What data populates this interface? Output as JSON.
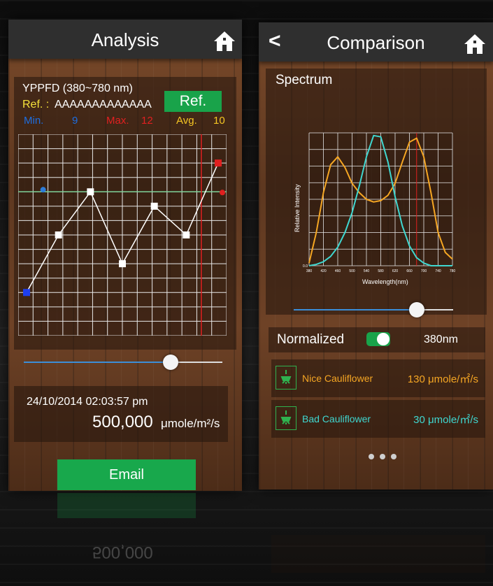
{
  "analysis": {
    "title": "Analysis",
    "ypppfd_label": "YPPFD  (380~780 nm)",
    "ref_label": "Ref. :",
    "ref_value": "AAAAAAAAAAAAA",
    "ref_button": "Ref.",
    "min_label": "Min.",
    "min_value": "9",
    "max_label": "Max.",
    "max_value": "12",
    "avg_label": "Avg.",
    "avg_value": "10",
    "datetime": "24/10/2014   02:03:57 pm",
    "measurement_value": "500,000",
    "measurement_unit": "μmole/m²/s",
    "email_button": "Email",
    "slider_value": 0.74,
    "chart_data": {
      "type": "line",
      "series": [
        {
          "values": [
            3,
            7,
            10,
            5,
            9,
            7,
            12
          ]
        }
      ],
      "markers": {
        "min": 9,
        "max": 12,
        "avg": 10
      },
      "grid": true
    }
  },
  "comparison": {
    "title": "Comparison",
    "back_icon": "<",
    "spectrum_label": "Spectrum",
    "normalized_label": "Normalized",
    "normalized_on": true,
    "wavelength_value": "380nm",
    "slider_value": 0.77,
    "items": [
      {
        "name": "Nice Cauliflower",
        "value": "130 μmole/㎡/s",
        "color": "#f5a623"
      },
      {
        "name": "Bad Cauliflower",
        "value": "30 μmole/㎡/s",
        "color": "#3fd7d0"
      }
    ],
    "pagination": [
      "•",
      "•",
      "•"
    ],
    "chart_data": {
      "type": "line",
      "xlabel": "Wavelength(nm)",
      "ylabel": "Relative Intensity",
      "x_ticks": [
        "380",
        "420",
        "460",
        "500",
        "540",
        "580",
        "620",
        "660",
        "700",
        "740",
        "780"
      ],
      "y_ticks": [
        "0.0"
      ],
      "xlim": [
        380,
        780
      ],
      "marker_x": 680,
      "series": [
        {
          "color": "#f5a623",
          "x": [
            380,
            400,
            420,
            440,
            460,
            480,
            500,
            520,
            540,
            560,
            580,
            600,
            620,
            640,
            660,
            680,
            700,
            720,
            740,
            760,
            780
          ],
          "y": [
            0.02,
            0.25,
            0.55,
            0.76,
            0.82,
            0.74,
            0.62,
            0.55,
            0.5,
            0.48,
            0.49,
            0.53,
            0.62,
            0.78,
            0.93,
            0.96,
            0.82,
            0.55,
            0.25,
            0.1,
            0.05
          ]
        },
        {
          "color": "#3fd7d0",
          "x": [
            380,
            400,
            420,
            440,
            460,
            480,
            500,
            520,
            540,
            560,
            580,
            600,
            620,
            640,
            660,
            680,
            700,
            720,
            740,
            760,
            780
          ],
          "y": [
            0.0,
            0.01,
            0.03,
            0.07,
            0.14,
            0.25,
            0.4,
            0.6,
            0.82,
            0.98,
            0.97,
            0.78,
            0.52,
            0.3,
            0.15,
            0.06,
            0.02,
            0.0,
            0.0,
            0.0,
            0.0
          ]
        }
      ],
      "grid": true
    }
  },
  "colors": {
    "accent_green": "#19a34a",
    "min_blue": "#1e5bd8",
    "max_red": "#e02020",
    "avg_yellow": "#f5c623",
    "ref_yellow": "#f5e13a"
  }
}
